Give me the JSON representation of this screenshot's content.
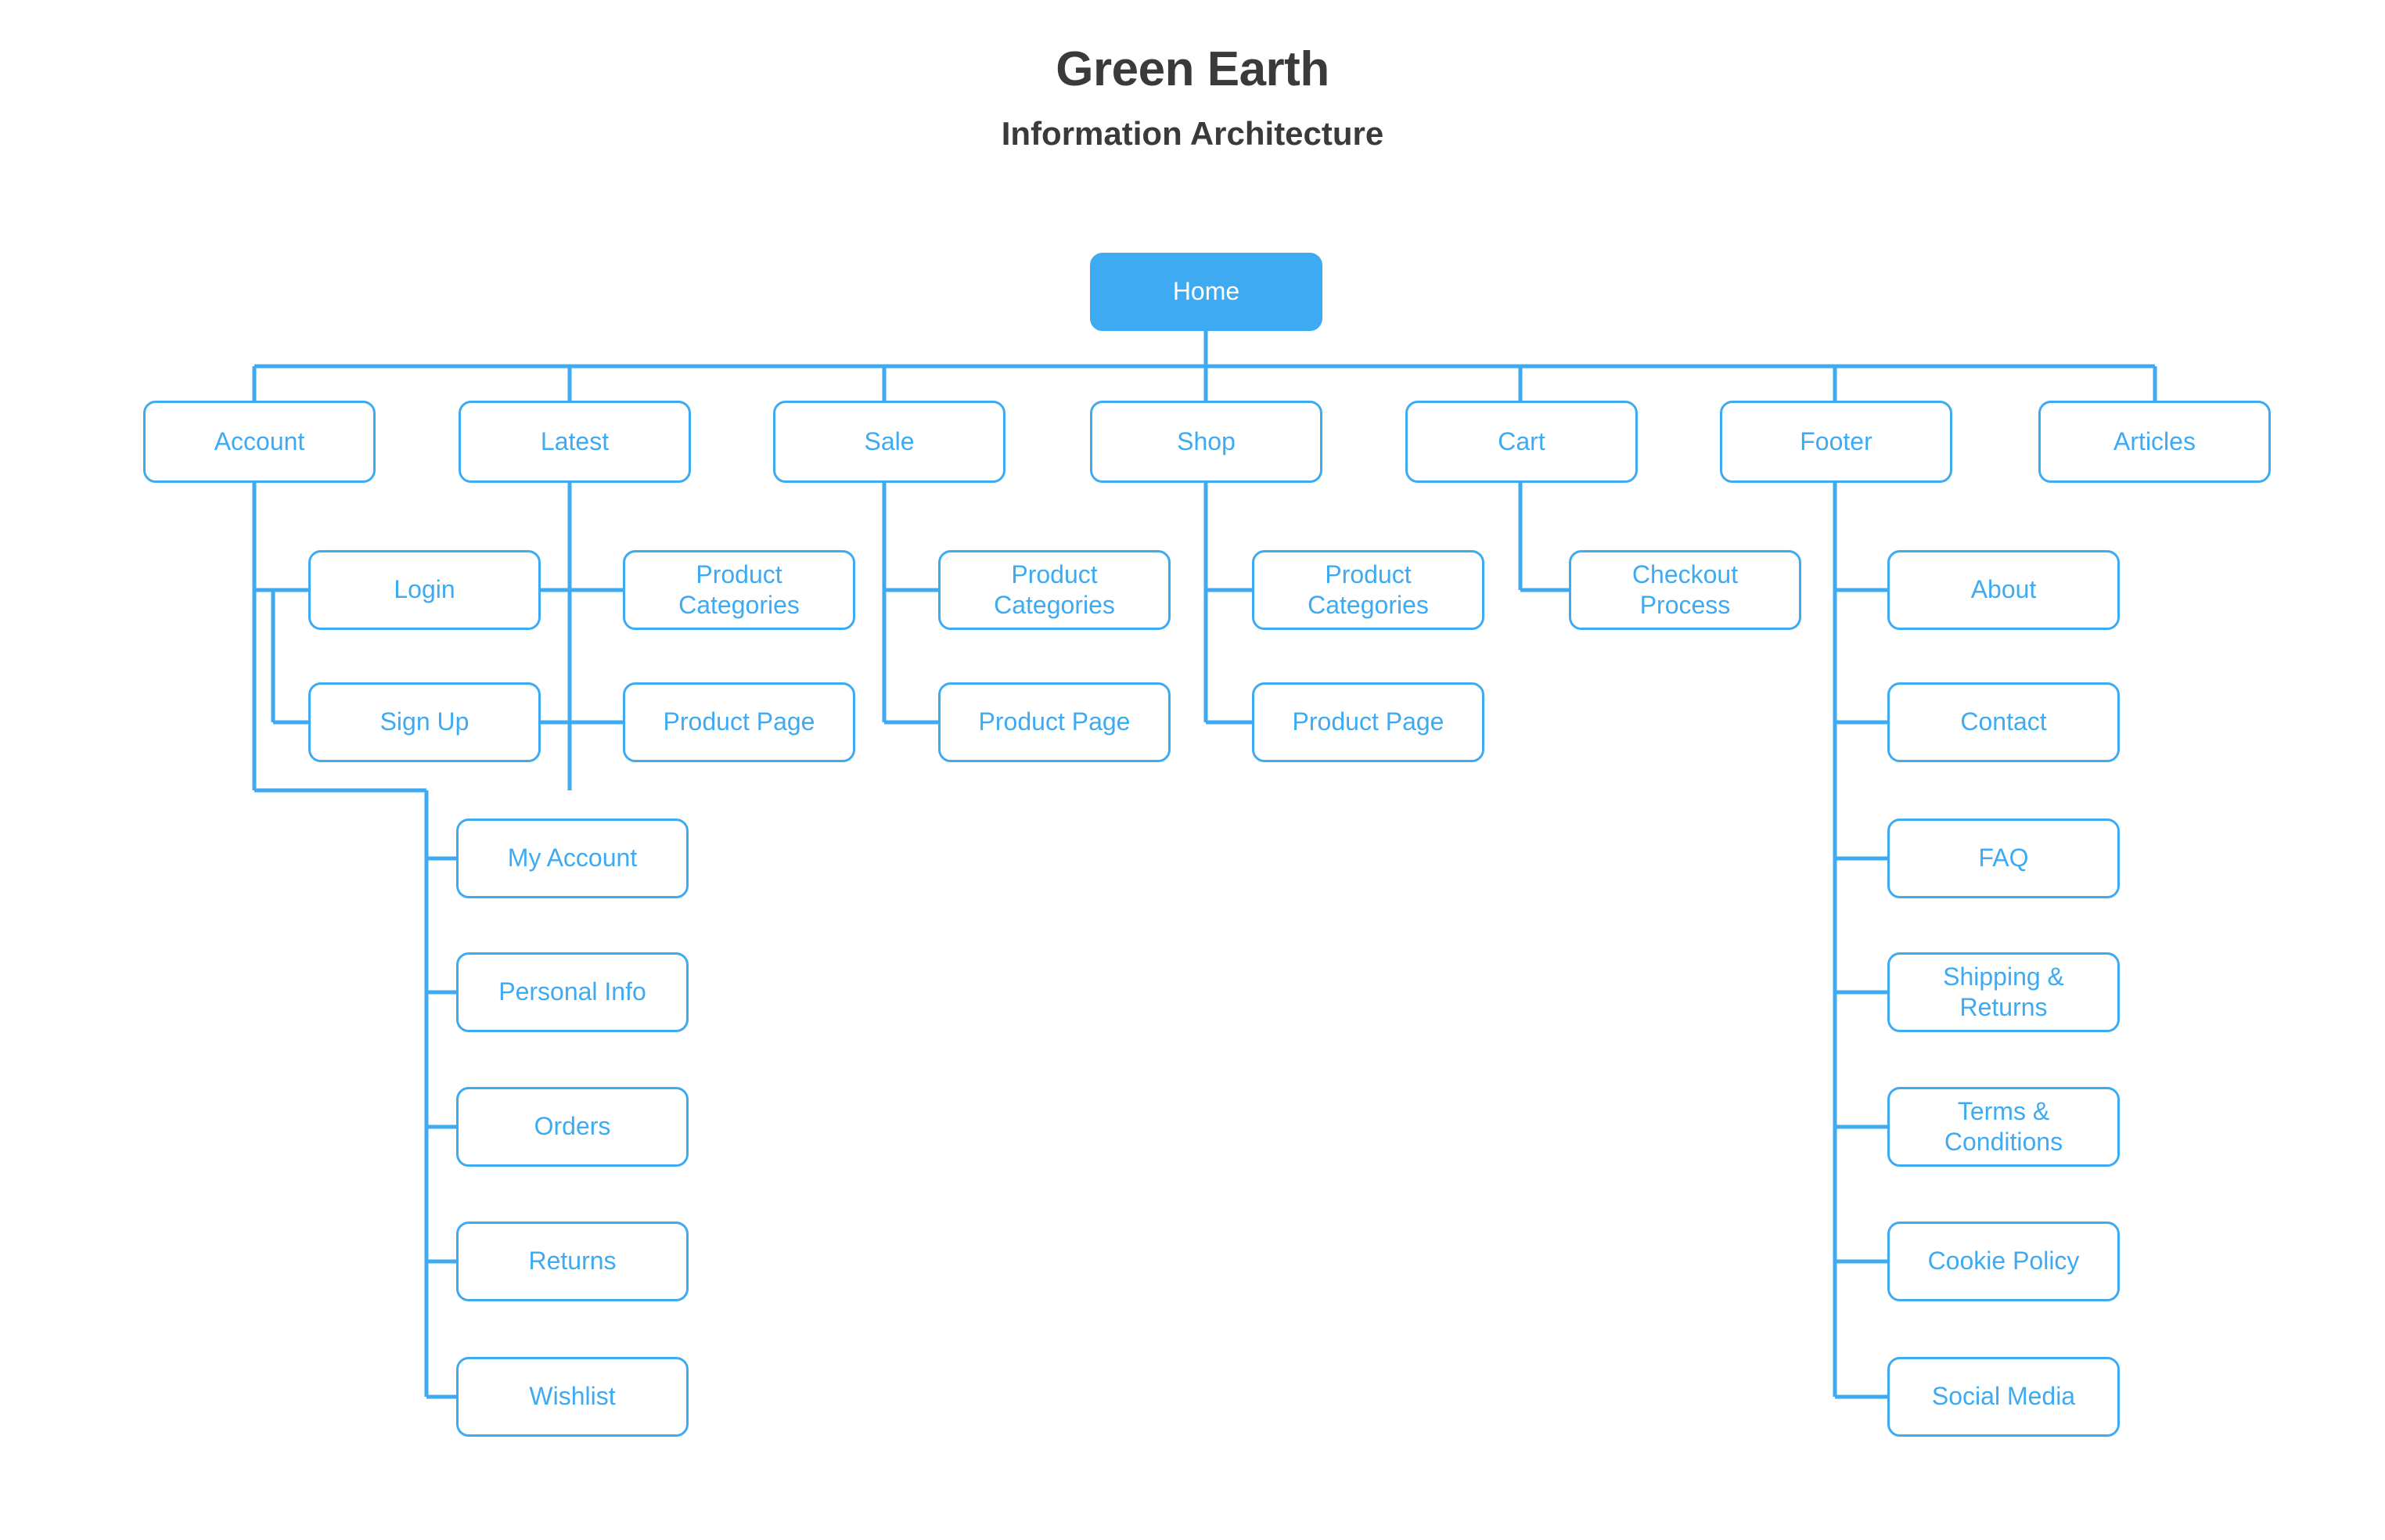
{
  "header": {
    "title": "Green Earth",
    "subtitle": "Information Architecture"
  },
  "colors": {
    "accent": "#3eaaf2",
    "node_border": "#3eaaf2",
    "node_text": "#3eaaf2",
    "root_fill": "#3eaaf2",
    "root_text": "#ffffff",
    "connector": "#3eaaf2",
    "title_text": "#3a3a3c",
    "background": "#ffffff"
  },
  "diagram": {
    "type": "sitemap-tree",
    "root": {
      "label": "Home"
    },
    "level1": [
      {
        "label": "Account"
      },
      {
        "label": "Latest"
      },
      {
        "label": "Sale"
      },
      {
        "label": "Shop"
      },
      {
        "label": "Cart"
      },
      {
        "label": "Footer"
      },
      {
        "label": "Articles"
      }
    ],
    "account_children": [
      {
        "label": "Login"
      },
      {
        "label": "Sign Up"
      }
    ],
    "account_subpages": [
      {
        "label": "My Account"
      },
      {
        "label": "Personal Info"
      },
      {
        "label": "Orders"
      },
      {
        "label": "Returns"
      },
      {
        "label": "Wishlist"
      }
    ],
    "latest_children": [
      {
        "label": "Product\nCategories"
      },
      {
        "label": "Product Page"
      }
    ],
    "sale_children": [
      {
        "label": "Product\nCategories"
      },
      {
        "label": "Product Page"
      }
    ],
    "shop_children": [
      {
        "label": "Product\nCategories"
      },
      {
        "label": "Product Page"
      }
    ],
    "cart_children": [
      {
        "label": "Checkout\nProcess"
      }
    ],
    "footer_children": [
      {
        "label": "About"
      },
      {
        "label": "Contact"
      },
      {
        "label": "FAQ"
      },
      {
        "label": "Shipping & Returns"
      },
      {
        "label": "Terms & Conditions"
      },
      {
        "label": "Cookie Policy"
      },
      {
        "label": "Social Media"
      }
    ],
    "articles_children": []
  }
}
